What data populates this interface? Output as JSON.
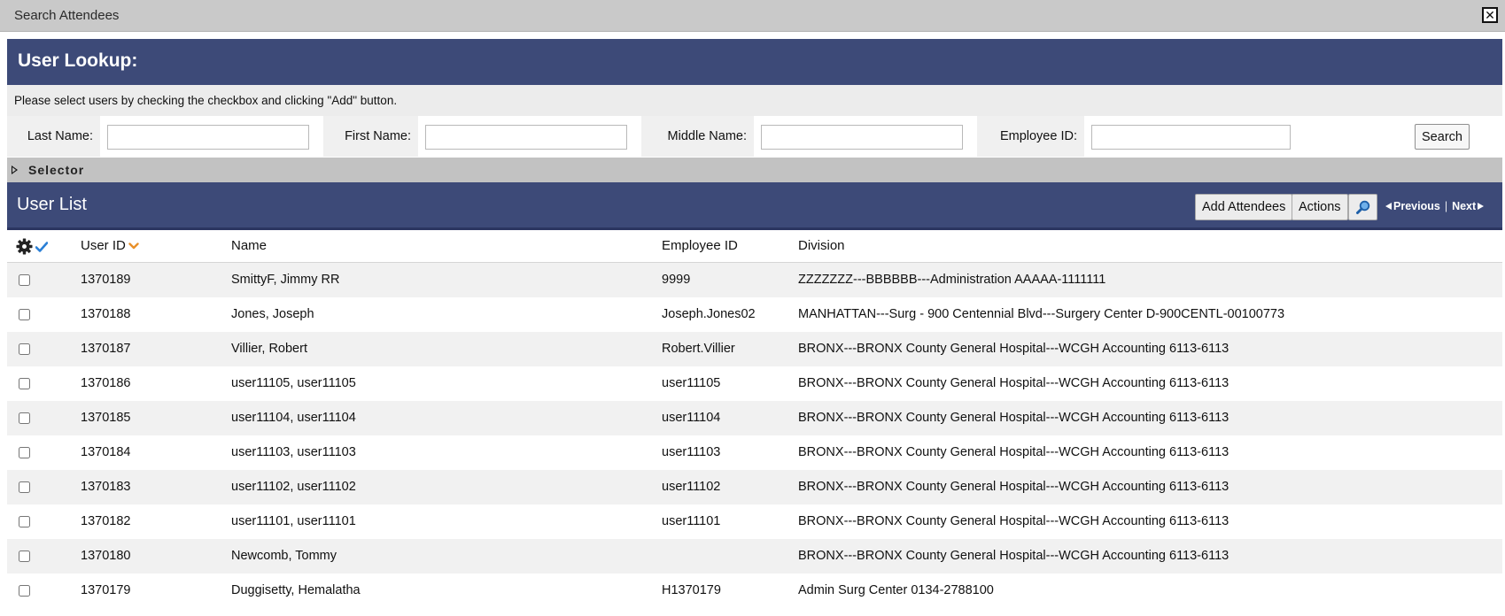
{
  "window": {
    "title": "Search Attendees",
    "close_glyph": "✕"
  },
  "lookup": {
    "title": "User Lookup:",
    "instructions": "Please select users by checking the checkbox and clicking \"Add\" button."
  },
  "search": {
    "last_name_label": "Last Name:",
    "first_name_label": "First Name:",
    "middle_name_label": "Middle Name:",
    "employee_id_label": "Employee ID:",
    "last_name_value": "",
    "first_name_value": "",
    "middle_name_value": "",
    "employee_id_value": "",
    "search_button": "Search"
  },
  "selector": {
    "label": "Selector"
  },
  "user_list": {
    "title": "User List",
    "add_attendees_button": "Add Attendees",
    "actions_button": "Actions",
    "previous_label": "Previous",
    "separator": "|",
    "next_label": "Next"
  },
  "table": {
    "columns": {
      "user_id": "User ID",
      "name": "Name",
      "employee_id": "Employee ID",
      "division": "Division"
    },
    "rows": [
      {
        "user_id": "1370189",
        "name": "SmittyF, Jimmy RR",
        "employee_id": "9999",
        "division": "ZZZZZZZ---BBBBBB---Administration AAAAA-1111111"
      },
      {
        "user_id": "1370188",
        "name": "Jones, Joseph",
        "employee_id": "Joseph.Jones02",
        "division": "MANHATTAN---Surg - 900 Centennial Blvd---Surgery Center D-900CENTL-00100773"
      },
      {
        "user_id": "1370187",
        "name": "Villier, Robert",
        "employee_id": "Robert.Villier",
        "division": "BRONX---BRONX County General Hospital---WCGH Accounting 6113-6113"
      },
      {
        "user_id": "1370186",
        "name": "user11105, user11105",
        "employee_id": "user11105",
        "division": "BRONX---BRONX County General Hospital---WCGH Accounting 6113-6113"
      },
      {
        "user_id": "1370185",
        "name": "user11104, user11104",
        "employee_id": "user11104",
        "division": "BRONX---BRONX County General Hospital---WCGH Accounting 6113-6113"
      },
      {
        "user_id": "1370184",
        "name": "user11103, user11103",
        "employee_id": "user11103",
        "division": "BRONX---BRONX County General Hospital---WCGH Accounting 6113-6113"
      },
      {
        "user_id": "1370183",
        "name": "user11102, user11102",
        "employee_id": "user11102",
        "division": "BRONX---BRONX County General Hospital---WCGH Accounting 6113-6113"
      },
      {
        "user_id": "1370182",
        "name": "user11101, user11101",
        "employee_id": "user11101",
        "division": "BRONX---BRONX County General Hospital---WCGH Accounting 6113-6113"
      },
      {
        "user_id": "1370180",
        "name": "Newcomb, Tommy",
        "employee_id": "",
        "division": "BRONX---BRONX County General Hospital---WCGH Accounting 6113-6113"
      },
      {
        "user_id": "1370179",
        "name": "Duggisetty, Hemalatha",
        "employee_id": "H1370179",
        "division": "Admin Surg Center 0134-2788100"
      }
    ]
  },
  "colors": {
    "header_bg": "#3d4a78",
    "title_bar_bg": "#c9c9c9",
    "selector_bg": "#c2c2c2",
    "row_alt_bg": "#f1f1f1",
    "check_icon": "#2a7fd6",
    "sort_icon": "#e8902a"
  },
  "icons": {
    "close": "close-icon",
    "settings": "gear-icon",
    "select_all": "checkmark-icon",
    "sort": "chevron-down-icon",
    "zoom": "magnifier-icon",
    "selector_toggle": "triangle-right-icon",
    "previous": "triangle-left-icon",
    "next": "triangle-right-icon"
  }
}
